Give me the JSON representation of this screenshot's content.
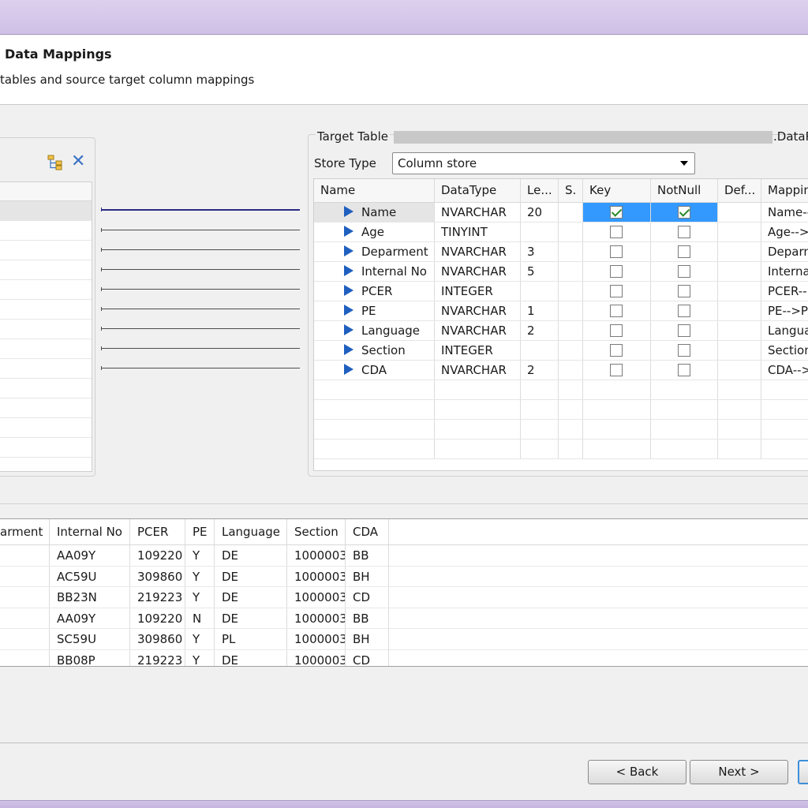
{
  "header": {
    "title": "Data Mappings",
    "description": "tables and source target column mappings"
  },
  "target": {
    "legend": "Target Table",
    "legend_suffix": ".DataR",
    "store_type_label": "Store Type",
    "store_type_value": "Column store",
    "columns": [
      "Name",
      "DataType",
      "Le...",
      "S.",
      "Key",
      "NotNull",
      "Def...",
      "Mappin"
    ],
    "rows": [
      {
        "name": "Name",
        "type": "NVARCHAR",
        "length": "20",
        "key": true,
        "notnull": true,
        "mapping": "Name--"
      },
      {
        "name": "Age",
        "type": "TINYINT",
        "length": "",
        "key": false,
        "notnull": false,
        "mapping": "Age-->"
      },
      {
        "name": "Deparment",
        "type": "NVARCHAR",
        "length": "3",
        "key": false,
        "notnull": false,
        "mapping": "Deparm"
      },
      {
        "name": "Internal No",
        "type": "NVARCHAR",
        "length": "5",
        "key": false,
        "notnull": false,
        "mapping": "Internal"
      },
      {
        "name": "PCER",
        "type": "INTEGER",
        "length": "",
        "key": false,
        "notnull": false,
        "mapping": "PCER--"
      },
      {
        "name": "PE",
        "type": "NVARCHAR",
        "length": "1",
        "key": false,
        "notnull": false,
        "mapping": "PE-->P"
      },
      {
        "name": "Language",
        "type": "NVARCHAR",
        "length": "2",
        "key": false,
        "notnull": false,
        "mapping": "Langua"
      },
      {
        "name": "Section",
        "type": "INTEGER",
        "length": "",
        "key": false,
        "notnull": false,
        "mapping": "Section"
      },
      {
        "name": "CDA",
        "type": "NVARCHAR",
        "length": "2",
        "key": false,
        "notnull": false,
        "mapping": "CDA-->"
      }
    ]
  },
  "preview": {
    "columns": [
      "arment",
      "Internal No",
      "PCER",
      "PE",
      "Language",
      "Section",
      "CDA"
    ],
    "rows": [
      [
        "",
        "AA09Y",
        "109220",
        "Y",
        "DE",
        "1000003",
        "BB"
      ],
      [
        "",
        "AC59U",
        "309860",
        "Y",
        "DE",
        "1000003",
        "BH"
      ],
      [
        "",
        "BB23N",
        "219223",
        "Y",
        "DE",
        "1000003",
        "CD"
      ],
      [
        "",
        "AA09Y",
        "109220",
        "N",
        "DE",
        "1000003",
        "BB"
      ],
      [
        "",
        "SC59U",
        "309860",
        "Y",
        "PL",
        "1000003",
        "BH"
      ],
      [
        "",
        "BB08P",
        "219223",
        "Y",
        "DE",
        "1000003",
        "CD"
      ]
    ]
  },
  "buttons": {
    "back": "< Back",
    "next": "Next >",
    "finish": ""
  },
  "icons": {
    "tree": "tree-structure-icon",
    "remove": "close-icon",
    "row_marker": "triangle-right-icon"
  },
  "colors": {
    "accent": "#3399ff",
    "marker": "#1f5fbf"
  }
}
